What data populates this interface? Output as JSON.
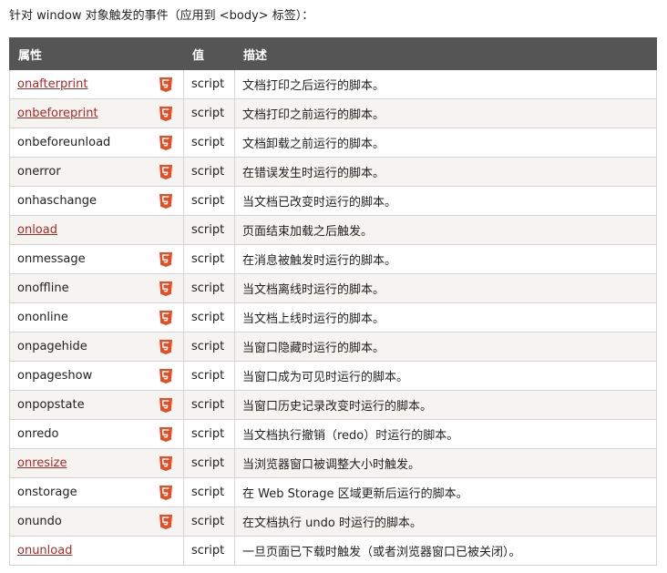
{
  "intro": "针对 window 对象触发的事件（应用到 <body> 标签）：",
  "table": {
    "headers": [
      "属性",
      "值",
      "描述"
    ],
    "rows": [
      {
        "attr": "onafterprint",
        "link": true,
        "html5": true,
        "value": "script",
        "desc": "文档打印之后运行的脚本。"
      },
      {
        "attr": "onbeforeprint",
        "link": true,
        "html5": true,
        "value": "script",
        "desc": "文档打印之前运行的脚本。"
      },
      {
        "attr": "onbeforeunload",
        "link": false,
        "html5": true,
        "value": "script",
        "desc": "文档卸载之前运行的脚本。"
      },
      {
        "attr": "onerror",
        "link": false,
        "html5": true,
        "value": "script",
        "desc": "在错误发生时运行的脚本。"
      },
      {
        "attr": "onhaschange",
        "link": false,
        "html5": true,
        "value": "script",
        "desc": "当文档已改变时运行的脚本。"
      },
      {
        "attr": "onload",
        "link": true,
        "html5": false,
        "value": "script",
        "desc": "页面结束加载之后触发。"
      },
      {
        "attr": "onmessage",
        "link": false,
        "html5": true,
        "value": "script",
        "desc": "在消息被触发时运行的脚本。"
      },
      {
        "attr": "onoffline",
        "link": false,
        "html5": true,
        "value": "script",
        "desc": "当文档离线时运行的脚本。"
      },
      {
        "attr": "ononline",
        "link": false,
        "html5": true,
        "value": "script",
        "desc": "当文档上线时运行的脚本。"
      },
      {
        "attr": "onpagehide",
        "link": false,
        "html5": true,
        "value": "script",
        "desc": "当窗口隐藏时运行的脚本。"
      },
      {
        "attr": "onpageshow",
        "link": false,
        "html5": true,
        "value": "script",
        "desc": "当窗口成为可见时运行的脚本。"
      },
      {
        "attr": "onpopstate",
        "link": false,
        "html5": true,
        "value": "script",
        "desc": "当窗口历史记录改变时运行的脚本。"
      },
      {
        "attr": "onredo",
        "link": false,
        "html5": true,
        "value": "script",
        "desc": "当文档执行撤销（redo）时运行的脚本。"
      },
      {
        "attr": "onresize",
        "link": true,
        "html5": true,
        "value": "script",
        "desc": "当浏览器窗口被调整大小时触发。"
      },
      {
        "attr": "onstorage",
        "link": false,
        "html5": true,
        "value": "script",
        "desc": "在 Web Storage 区域更新后运行的脚本。"
      },
      {
        "attr": "onundo",
        "link": false,
        "html5": true,
        "value": "script",
        "desc": "在文档执行 undo 时运行的脚本。"
      },
      {
        "attr": "onunload",
        "link": true,
        "html5": false,
        "value": "script",
        "desc": "一旦页面已下载时触发（或者浏览器窗口已被关闭）。"
      }
    ]
  },
  "colors": {
    "header_bg": "#555555",
    "link": "#a52a2a",
    "html5_badge": "#e44d26",
    "row_alt": "#f6f4f0"
  },
  "icons": {
    "html5_badge": "html5-icon"
  }
}
